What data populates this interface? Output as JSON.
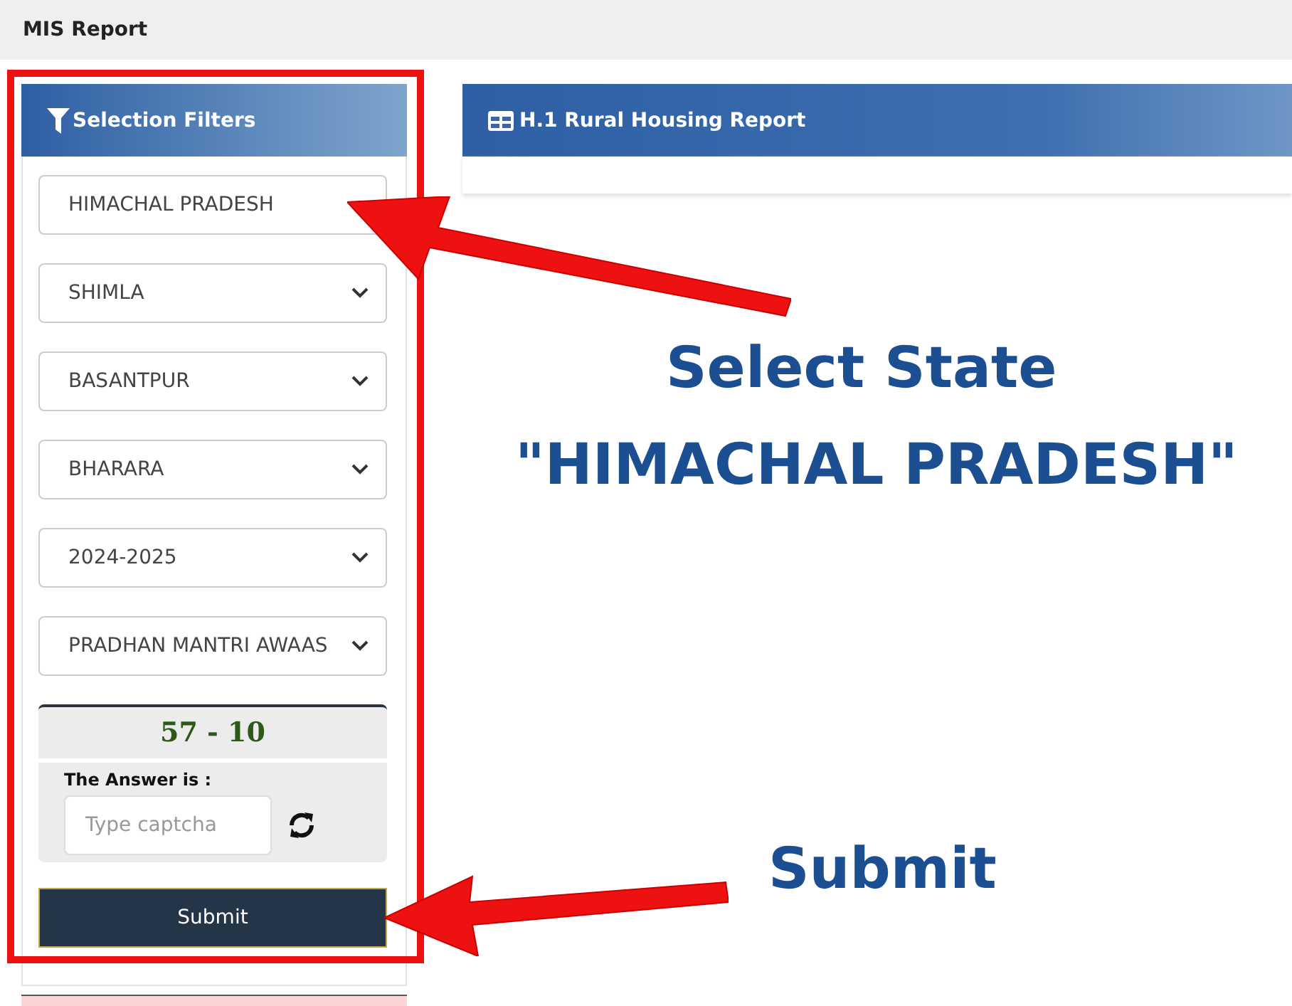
{
  "top_bar": {
    "title": "MIS Report"
  },
  "filters": {
    "title": "Selection Filters",
    "selects": [
      {
        "value": "HIMACHAL PRADESH",
        "chevron": false
      },
      {
        "value": "SHIMLA",
        "chevron": true
      },
      {
        "value": "BASANTPUR",
        "chevron": true
      },
      {
        "value": "BHARARA",
        "chevron": true
      },
      {
        "value": "2024-2025",
        "chevron": true
      },
      {
        "value": "PRADHAN MANTRI AWAAS",
        "chevron": true
      }
    ],
    "captcha": {
      "question": "57 - 10",
      "label": "The Answer is :",
      "placeholder": "Type captcha"
    },
    "submit": "Submit"
  },
  "report": {
    "title": "H.1 Rural Housing Report"
  },
  "annotations": {
    "state_hint": "Select State",
    "state_value": "\"HIMACHAL PRADESH\"",
    "submit_hint": "Submit"
  }
}
